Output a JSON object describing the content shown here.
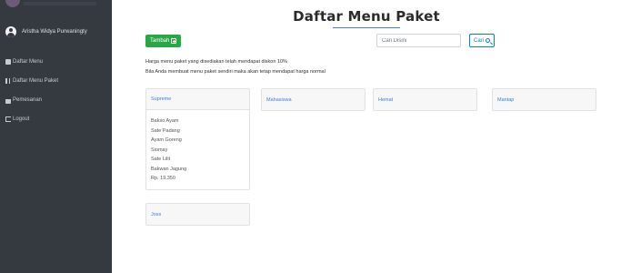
{
  "sidebar": {
    "user_name": "Aristha Widya Purwaningty",
    "items": [
      {
        "label": "Daftar Menu",
        "icon": "dashboard-icon"
      },
      {
        "label": "Daftar Menu Paket",
        "icon": "utensils-icon"
      },
      {
        "label": "Pemesanan",
        "icon": "shopping-bag-icon"
      },
      {
        "label": "Logout",
        "icon": "logout-icon"
      }
    ]
  },
  "main": {
    "title": "Daftar Menu Paket",
    "add_button_label": "Tambah",
    "search": {
      "placeholder": "Cari Disini",
      "value": ""
    },
    "search_button_label": "Cari",
    "info_lines": [
      "Harga menu paket yang disediakan telah mendapat diskon 10%",
      "Bila Anda membuat menu paket sendiri maka akan tetap mendapat harga normal"
    ],
    "packages": [
      {
        "name": "Supreme",
        "items": [
          "Bakso Ayam",
          "Sate Padang",
          "Ayam Goreng",
          "Siomay",
          "Sate Lilit",
          "Bakwan Jagung"
        ],
        "price": "Rp. 19,350"
      },
      {
        "name": "Mahasiswa"
      },
      {
        "name": "Hemat"
      },
      {
        "name": "Mantap"
      },
      {
        "name": "Joss"
      }
    ]
  },
  "colors": {
    "sidebar_bg": "#343a40",
    "accent": "#007bff",
    "success": "#28a745"
  }
}
